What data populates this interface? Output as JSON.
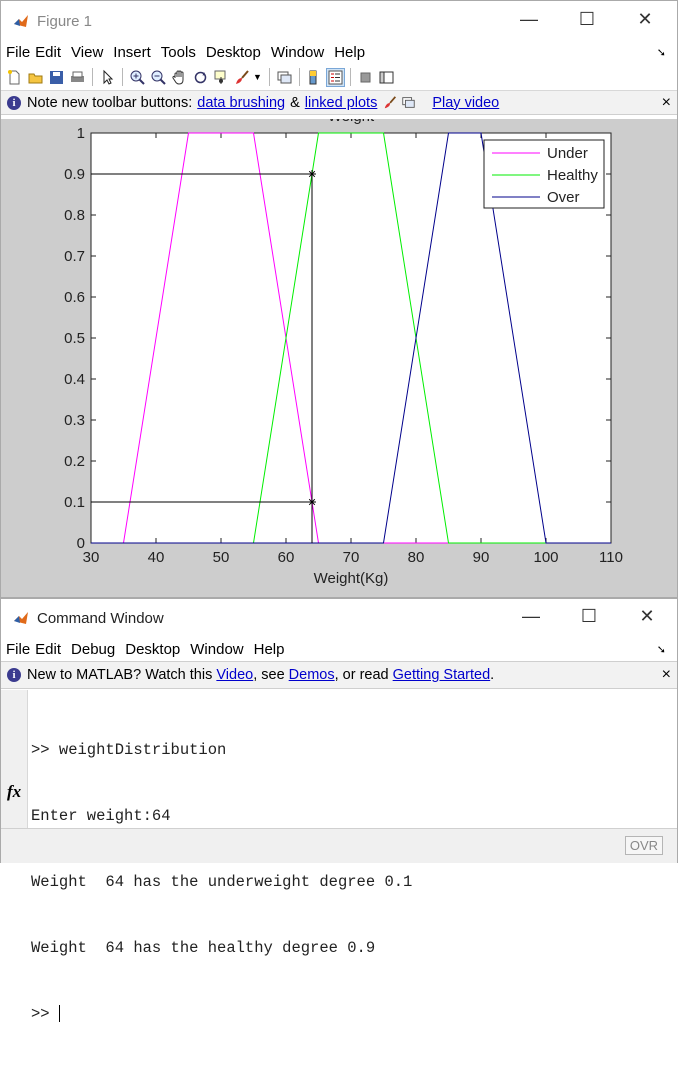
{
  "figure": {
    "title": "Figure 1",
    "menus": [
      "File",
      "Edit",
      "View",
      "Insert",
      "Tools",
      "Desktop",
      "Window",
      "Help"
    ],
    "info": {
      "text": "Note new toolbar buttons:",
      "link1": "data brushing",
      "amp": "&",
      "link2": "linked plots",
      "video": "Play video",
      "close": "×"
    },
    "toolbar_icons": [
      "new-file-icon",
      "open-folder-icon",
      "save-icon",
      "print-icon",
      "pointer-icon",
      "zoom-in-icon",
      "zoom-out-icon",
      "pan-icon",
      "rotate-icon",
      "data-cursor-icon",
      "brush-icon",
      "link-icon",
      "colorbar-icon",
      "legend-icon",
      "hide-plot-tools-icon",
      "show-plot-tools-icon"
    ]
  },
  "chart_data": {
    "type": "line",
    "title": "Weight",
    "xlabel": "Weight(Kg)",
    "ylabel": "",
    "xlim": [
      30,
      110
    ],
    "ylim": [
      0,
      1
    ],
    "xticks": [
      "30",
      "40",
      "50",
      "60",
      "70",
      "80",
      "90",
      "100",
      "110"
    ],
    "yticks": [
      "0",
      "0.1",
      "0.2",
      "0.3",
      "0.4",
      "0.5",
      "0.6",
      "0.7",
      "0.8",
      "0.9",
      "1"
    ],
    "legend_position": "top-right",
    "series": [
      {
        "name": "Under",
        "color": "#ff00ff",
        "x": [
          30,
          35,
          45,
          55,
          65,
          110
        ],
        "y": [
          0,
          0,
          1,
          1,
          0,
          0
        ]
      },
      {
        "name": "Healthy",
        "color": "#00ee00",
        "x": [
          30,
          55,
          65,
          75,
          85,
          110
        ],
        "y": [
          0,
          0,
          1,
          1,
          0,
          0
        ]
      },
      {
        "name": "Over",
        "color": "#00008b",
        "x": [
          30,
          75,
          85,
          90,
          100,
          110
        ],
        "y": [
          0,
          0,
          1,
          1,
          0,
          0
        ]
      }
    ],
    "markers": [
      {
        "x": 64,
        "y": 0.9
      },
      {
        "x": 64,
        "y": 0.1
      }
    ],
    "guides": [
      {
        "x1": 30,
        "y1": 0.9,
        "x2": 64,
        "y2": 0.9
      },
      {
        "x1": 30,
        "y1": 0.1,
        "x2": 64,
        "y2": 0.1
      },
      {
        "x1": 64,
        "y1": 0,
        "x2": 64,
        "y2": 0.9
      }
    ]
  },
  "command": {
    "title": "Command Window",
    "menus": [
      "File",
      "Edit",
      "Debug",
      "Desktop",
      "Window",
      "Help"
    ],
    "info": {
      "t1": "New to MATLAB? Watch this ",
      "video": "Video",
      "t2": ", see ",
      "demos": "Demos",
      "t3": ", or read ",
      "gs": "Getting Started",
      "t4": ".",
      "close": "×"
    },
    "lines": [
      ">> weightDistribution",
      "Enter weight:64",
      "Weight  64 has the underweight degree 0.1",
      "Weight  64 has the healthy degree 0.9"
    ],
    "prompt": ">> ",
    "fx": "fx",
    "status": "OVR"
  }
}
